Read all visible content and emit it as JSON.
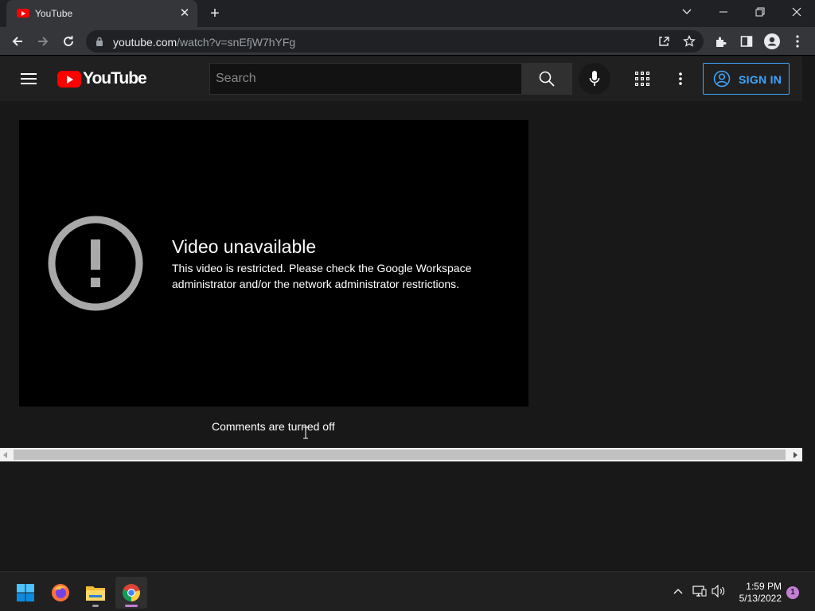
{
  "browser": {
    "tab_title": "YouTube",
    "url_host": "youtube.com",
    "url_path": "/watch?v=snEfjW7hYFg"
  },
  "youtube": {
    "wordmark": "YouTube",
    "search_placeholder": "Search",
    "signin_label": "SIGN IN",
    "accent_color": "#3ea6ff",
    "brand_color": "#ff0000"
  },
  "player": {
    "error_title": "Video unavailable",
    "error_message_line1": "This video is restricted. Please check the Google Workspace",
    "error_message_line2": "administrator and/or the network administrator restrictions."
  },
  "page": {
    "comments_status": "Comments are turned off"
  },
  "taskbar": {
    "time": "1:59 PM",
    "date": "5/13/2022",
    "notification_count": "1"
  }
}
